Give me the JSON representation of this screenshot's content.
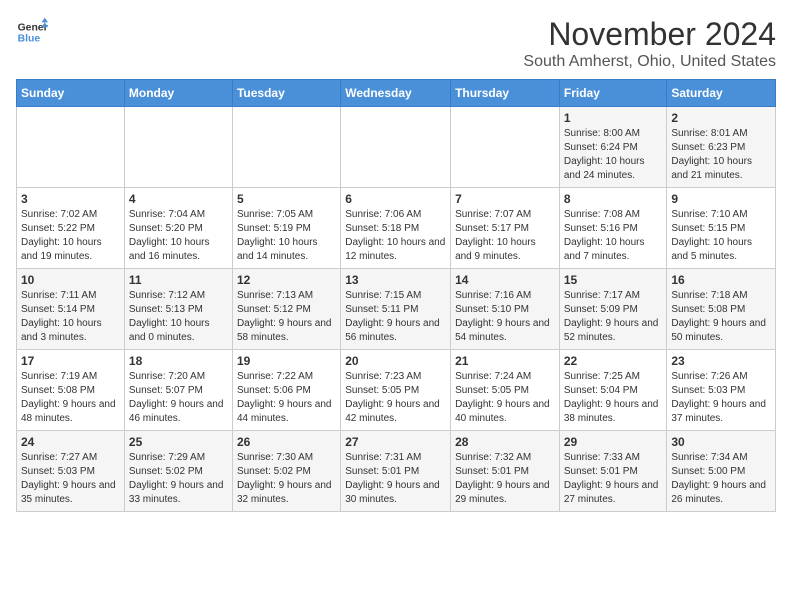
{
  "logo": {
    "line1": "General",
    "line2": "Blue"
  },
  "title": "November 2024",
  "location": "South Amherst, Ohio, United States",
  "weekdays": [
    "Sunday",
    "Monday",
    "Tuesday",
    "Wednesday",
    "Thursday",
    "Friday",
    "Saturday"
  ],
  "weeks": [
    [
      {
        "day": "",
        "info": ""
      },
      {
        "day": "",
        "info": ""
      },
      {
        "day": "",
        "info": ""
      },
      {
        "day": "",
        "info": ""
      },
      {
        "day": "",
        "info": ""
      },
      {
        "day": "1",
        "info": "Sunrise: 8:00 AM\nSunset: 6:24 PM\nDaylight: 10 hours and 24 minutes."
      },
      {
        "day": "2",
        "info": "Sunrise: 8:01 AM\nSunset: 6:23 PM\nDaylight: 10 hours and 21 minutes."
      }
    ],
    [
      {
        "day": "3",
        "info": "Sunrise: 7:02 AM\nSunset: 5:22 PM\nDaylight: 10 hours and 19 minutes."
      },
      {
        "day": "4",
        "info": "Sunrise: 7:04 AM\nSunset: 5:20 PM\nDaylight: 10 hours and 16 minutes."
      },
      {
        "day": "5",
        "info": "Sunrise: 7:05 AM\nSunset: 5:19 PM\nDaylight: 10 hours and 14 minutes."
      },
      {
        "day": "6",
        "info": "Sunrise: 7:06 AM\nSunset: 5:18 PM\nDaylight: 10 hours and 12 minutes."
      },
      {
        "day": "7",
        "info": "Sunrise: 7:07 AM\nSunset: 5:17 PM\nDaylight: 10 hours and 9 minutes."
      },
      {
        "day": "8",
        "info": "Sunrise: 7:08 AM\nSunset: 5:16 PM\nDaylight: 10 hours and 7 minutes."
      },
      {
        "day": "9",
        "info": "Sunrise: 7:10 AM\nSunset: 5:15 PM\nDaylight: 10 hours and 5 minutes."
      }
    ],
    [
      {
        "day": "10",
        "info": "Sunrise: 7:11 AM\nSunset: 5:14 PM\nDaylight: 10 hours and 3 minutes."
      },
      {
        "day": "11",
        "info": "Sunrise: 7:12 AM\nSunset: 5:13 PM\nDaylight: 10 hours and 0 minutes."
      },
      {
        "day": "12",
        "info": "Sunrise: 7:13 AM\nSunset: 5:12 PM\nDaylight: 9 hours and 58 minutes."
      },
      {
        "day": "13",
        "info": "Sunrise: 7:15 AM\nSunset: 5:11 PM\nDaylight: 9 hours and 56 minutes."
      },
      {
        "day": "14",
        "info": "Sunrise: 7:16 AM\nSunset: 5:10 PM\nDaylight: 9 hours and 54 minutes."
      },
      {
        "day": "15",
        "info": "Sunrise: 7:17 AM\nSunset: 5:09 PM\nDaylight: 9 hours and 52 minutes."
      },
      {
        "day": "16",
        "info": "Sunrise: 7:18 AM\nSunset: 5:08 PM\nDaylight: 9 hours and 50 minutes."
      }
    ],
    [
      {
        "day": "17",
        "info": "Sunrise: 7:19 AM\nSunset: 5:08 PM\nDaylight: 9 hours and 48 minutes."
      },
      {
        "day": "18",
        "info": "Sunrise: 7:20 AM\nSunset: 5:07 PM\nDaylight: 9 hours and 46 minutes."
      },
      {
        "day": "19",
        "info": "Sunrise: 7:22 AM\nSunset: 5:06 PM\nDaylight: 9 hours and 44 minutes."
      },
      {
        "day": "20",
        "info": "Sunrise: 7:23 AM\nSunset: 5:05 PM\nDaylight: 9 hours and 42 minutes."
      },
      {
        "day": "21",
        "info": "Sunrise: 7:24 AM\nSunset: 5:05 PM\nDaylight: 9 hours and 40 minutes."
      },
      {
        "day": "22",
        "info": "Sunrise: 7:25 AM\nSunset: 5:04 PM\nDaylight: 9 hours and 38 minutes."
      },
      {
        "day": "23",
        "info": "Sunrise: 7:26 AM\nSunset: 5:03 PM\nDaylight: 9 hours and 37 minutes."
      }
    ],
    [
      {
        "day": "24",
        "info": "Sunrise: 7:27 AM\nSunset: 5:03 PM\nDaylight: 9 hours and 35 minutes."
      },
      {
        "day": "25",
        "info": "Sunrise: 7:29 AM\nSunset: 5:02 PM\nDaylight: 9 hours and 33 minutes."
      },
      {
        "day": "26",
        "info": "Sunrise: 7:30 AM\nSunset: 5:02 PM\nDaylight: 9 hours and 32 minutes."
      },
      {
        "day": "27",
        "info": "Sunrise: 7:31 AM\nSunset: 5:01 PM\nDaylight: 9 hours and 30 minutes."
      },
      {
        "day": "28",
        "info": "Sunrise: 7:32 AM\nSunset: 5:01 PM\nDaylight: 9 hours and 29 minutes."
      },
      {
        "day": "29",
        "info": "Sunrise: 7:33 AM\nSunset: 5:01 PM\nDaylight: 9 hours and 27 minutes."
      },
      {
        "day": "30",
        "info": "Sunrise: 7:34 AM\nSunset: 5:00 PM\nDaylight: 9 hours and 26 minutes."
      }
    ]
  ]
}
